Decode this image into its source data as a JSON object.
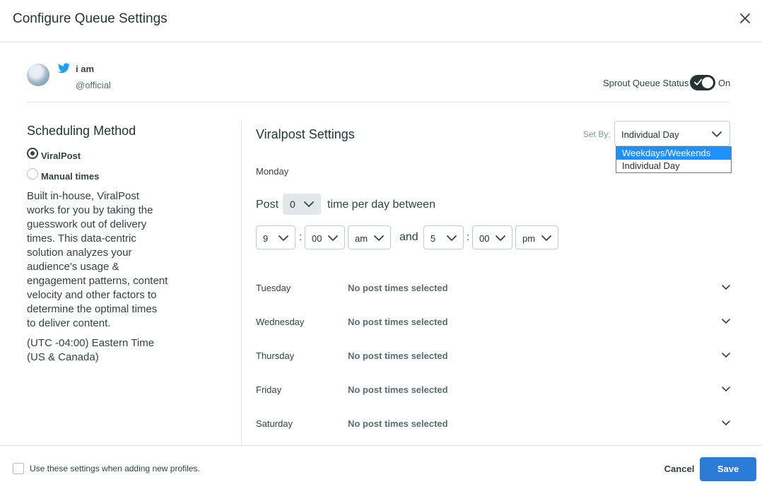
{
  "dialog": {
    "title": "Configure Queue Settings"
  },
  "profile": {
    "name": "i am",
    "handle": "@official",
    "network_icon": "twitter-icon"
  },
  "queue_status": {
    "label": "Sprout Queue Status",
    "state": "On",
    "enabled": true
  },
  "scheduling": {
    "title": "Scheduling Method",
    "options": [
      {
        "label": "ViralPost",
        "selected": true
      },
      {
        "label": "Manual times",
        "selected": false
      }
    ],
    "description": "Built in-house, ViralPost works for you by taking the guesswork out of delivery times. This data-centric solution analyzes your audience's usage & engagement patterns, content velocity and other factors to determine the optimal times to deliver content.",
    "timezone": "(UTC -04:00) Eastern Time (US & Canada)"
  },
  "viralpost": {
    "title": "Viralpost Settings",
    "set_by": {
      "label": "Set By:",
      "value": "Individual Day",
      "options": [
        "Weekdays/Weekends",
        "Individual Day"
      ],
      "highlighted": "Weekdays/Weekends"
    },
    "monday": {
      "day": "Monday",
      "post_label": "Post",
      "post_count": "0",
      "post_suffix": "time per day between",
      "start": {
        "hour": "9",
        "minute": "00",
        "period": "am"
      },
      "and_label": "and",
      "end": {
        "hour": "5",
        "minute": "00",
        "period": "pm"
      }
    },
    "days": [
      {
        "day": "Tuesday",
        "status": "No post times selected"
      },
      {
        "day": "Wednesday",
        "status": "No post times selected"
      },
      {
        "day": "Thursday",
        "status": "No post times selected"
      },
      {
        "day": "Friday",
        "status": "No post times selected"
      },
      {
        "day": "Saturday",
        "status": "No post times selected"
      }
    ]
  },
  "footer": {
    "checkbox_label": "Use these settings when adding new profiles.",
    "cancel": "Cancel",
    "save": "Save"
  },
  "colors": {
    "primary": "#2b7bd7",
    "toggle": "#273333",
    "highlight": "#1e90ff"
  }
}
